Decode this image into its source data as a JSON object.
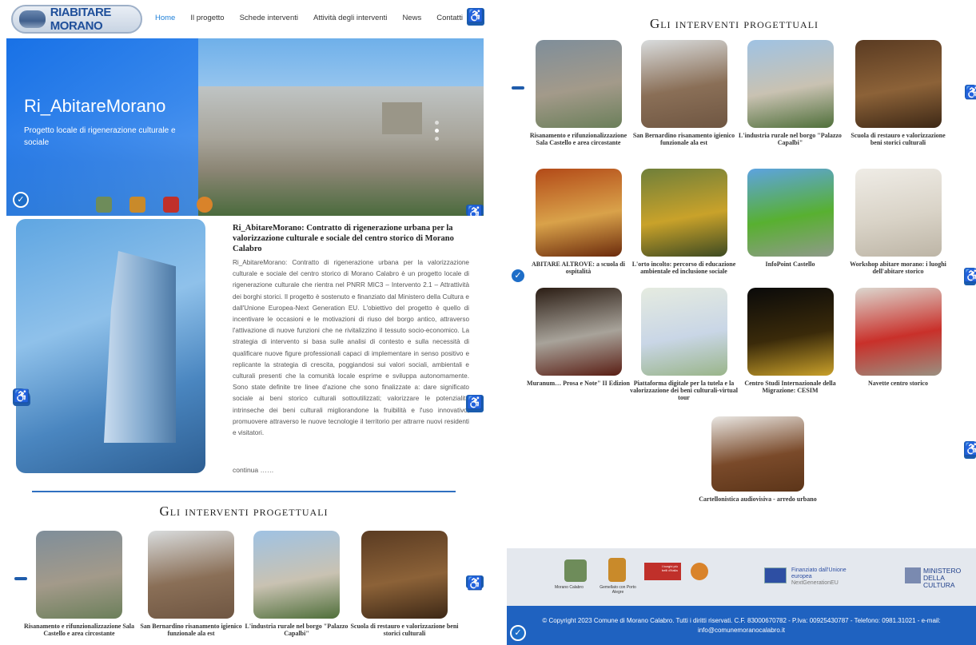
{
  "header": {
    "logo_text": "RIABITARE MORANO",
    "menu": [
      "Home",
      "Il progetto",
      "Schede interventi",
      "Attività degli interventi",
      "News",
      "Contatti"
    ]
  },
  "hero": {
    "title": "Ri_AbitareMorano",
    "subtitle": "Progetto locale di rigenerazione culturale e sociale"
  },
  "intro": {
    "title": "Ri_AbitareMorano: Contratto di rigenerazione urbana per la valorizzazione culturale e sociale del centro storico di Morano Calabro",
    "text": "Ri_AbitareMorano: Contratto di rigenerazione urbana per la valorizzazione culturale e sociale del centro storico di Morano Calabro è un progetto locale di rigenerazione culturale che rientra nel PNRR MIC3 – Intervento 2.1 – Attrattività dei borghi storici. Il progetto è sostenuto e finanziato dal Ministero della Cultura e dall'Unione Europea-Next Generation EU. L'obiettivo del progetto è quello di incentivare le occasioni e le motivazioni di riuso del borgo antico, attraverso l'attivazione di nuove funzioni che ne rivitalizzino il tessuto socio-economico. La strategia di intervento si basa sulle analisi di contesto e sulla necessità di qualificare nuove figure professionali capaci di implementare in senso positivo e replicante la strategia di crescita, poggiandosi sui valori sociali, ambientali e culturali presenti che la comunità locale esprime e sviluppa autonomamente. Sono state definite tre linee d'azione che sono finalizzate a: dare significato sociale ai beni storico culturali sottoutilizzati; valorizzare le potenzialità intrinseche dei beni culturali migliorandone la fruibilità e l'uso innovativo; promuovere attraverso le nuove tecnologie il territorio per attrarre nuovi residenti e visitatori.",
    "more": "continua ……"
  },
  "section_title": "Gli interventi progettuali",
  "interventions": [
    {
      "label": "Risanamento e rifunzionalizzazione Sala Castello e area circostante",
      "colors": [
        "#7f8e9a",
        "#a39a8a",
        "#6b7f5a"
      ]
    },
    {
      "label": "San Bernardino risanamento igienico funzionale ala est",
      "colors": [
        "#d9dcdd",
        "#8a6f57",
        "#6f5642"
      ]
    },
    {
      "label": "L'industria rurale nel borgo \"Palazzo Capalbi\"",
      "colors": [
        "#9fc2e3",
        "#c9c2b2",
        "#4f6f3a"
      ]
    },
    {
      "label": "Scuola di restauro e valorizzazione beni storici culturali",
      "colors": [
        "#5a3b22",
        "#8c6238",
        "#3d2816"
      ]
    },
    {
      "label": "ABITARE ALTROVE: a scuola di ospitalità",
      "colors": [
        "#b34a18",
        "#d9a24a",
        "#6b2a0c"
      ]
    },
    {
      "label": "L'orto incolto: percorso di educazione ambientale ed inclusione sociale",
      "colors": [
        "#6f7f3a",
        "#c9a22a",
        "#3d4a22"
      ]
    },
    {
      "label": "InfoPoint Castello",
      "colors": [
        "#5da3e0",
        "#58b030",
        "#8f9a8a"
      ]
    },
    {
      "label": "Workshop abitare morano: i luoghi dell'abitare storico",
      "colors": [
        "#efece6",
        "#d9d3c7",
        "#bdb5a6"
      ]
    },
    {
      "label": "Muranum… Prosa e Note\" II Edizion",
      "colors": [
        "#2b1d14",
        "#a8a39a",
        "#5a1e14"
      ]
    },
    {
      "label": "Piattaforma digitale per la tutela e la valorizzazione dei beni culturali-virtual tour",
      "colors": [
        "#e5ebe0",
        "#c9d6e6",
        "#9ab58a"
      ]
    },
    {
      "label": "Centro Studi Internazionale della Migrazione: CESIM",
      "colors": [
        "#0a0a0a",
        "#3a2a0a",
        "#c9a02a"
      ]
    },
    {
      "label": "Navette centro storico",
      "colors": [
        "#dcd7cf",
        "#c9302a",
        "#9a8f80"
      ]
    },
    {
      "label": "Cartellonistica audiovisiva - arredo urbano",
      "colors": [
        "#e9e6e2",
        "#7a4a2a",
        "#5c3519"
      ]
    }
  ],
  "footer": {
    "logo_labels": [
      "Morano Calabro",
      "Gemellato con Porto Alegre",
      "I borghi più belli d'Italia"
    ],
    "eu_text": "Finanziato dall'Unione europea",
    "eu_sub": "NextGenerationEU",
    "ministry_1": "MINISTERO",
    "ministry_2": "DELLA",
    "ministry_3": "CULTURA",
    "copyright": "© Copyright 2023 Comune di Morano Calabro. Tutti i diritti riservati. C.F. 83000670782 - P.Iva: 00925430787 - Telefono: 0981.31021 - e-mail: info@comunemoranocalabro.it"
  },
  "icons": {
    "accessibility": "accessibility-icon",
    "round": "accessibility-toggle-icon"
  }
}
